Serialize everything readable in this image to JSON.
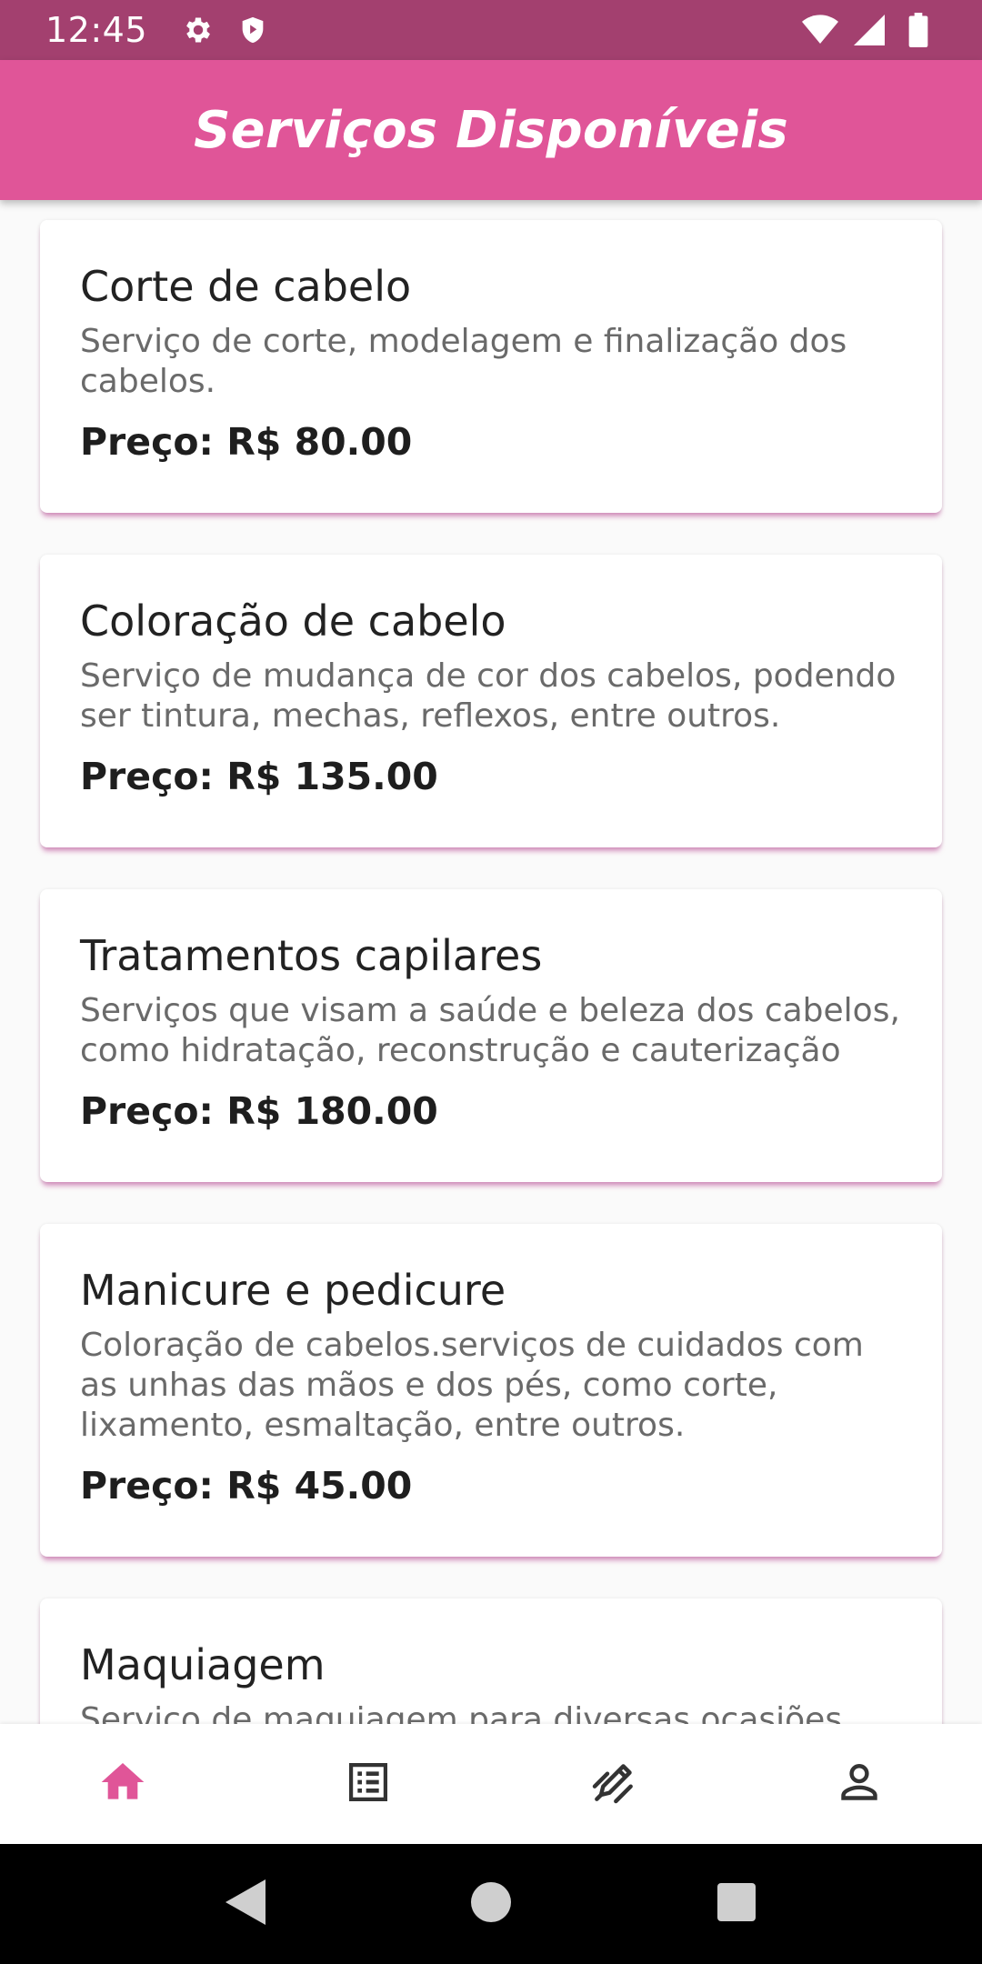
{
  "status_bar": {
    "time": "12:45",
    "icons": [
      "gear-icon",
      "shield-play-icon",
      "wifi-icon",
      "signal-icon",
      "battery-icon"
    ]
  },
  "app_bar": {
    "title": "Serviços Disponíveis"
  },
  "services": [
    {
      "title": "Corte de cabelo",
      "description": "Serviço de corte, modelagem e finalização dos cabelos.",
      "price": "Preço: R$ 80.00"
    },
    {
      "title": "Coloração de cabelo",
      "description": "Serviço de mudança de cor dos cabelos, podendo ser tintura, mechas, reflexos, entre outros.",
      "price": "Preço: R$ 135.00"
    },
    {
      "title": "Tratamentos capilares",
      "description": "Serviços que visam a saúde e beleza dos cabelos, como hidratação, reconstrução e cauterização",
      "price": "Preço: R$ 180.00"
    },
    {
      "title": "Manicure e pedicure",
      "description": "Coloração de cabelos.serviços de cuidados com as unhas das mãos e dos pés, como corte, lixamento, esmaltação, entre outros.",
      "price": "Preço: R$ 45.00"
    },
    {
      "title": "Maquiagem",
      "description": "Serviço de maquiagem para diversas ocasiões",
      "price": ""
    }
  ],
  "bottom_nav": {
    "items": [
      {
        "icon": "home-icon",
        "active": true
      },
      {
        "icon": "list-icon",
        "active": false
      },
      {
        "icon": "edit-icon",
        "active": false
      },
      {
        "icon": "person-icon",
        "active": false
      }
    ],
    "active_color": "#e05598",
    "inactive_color": "#333333"
  },
  "colors": {
    "status_bar": "#a3406f",
    "app_bar": "#e05598",
    "background": "#fafafa"
  }
}
